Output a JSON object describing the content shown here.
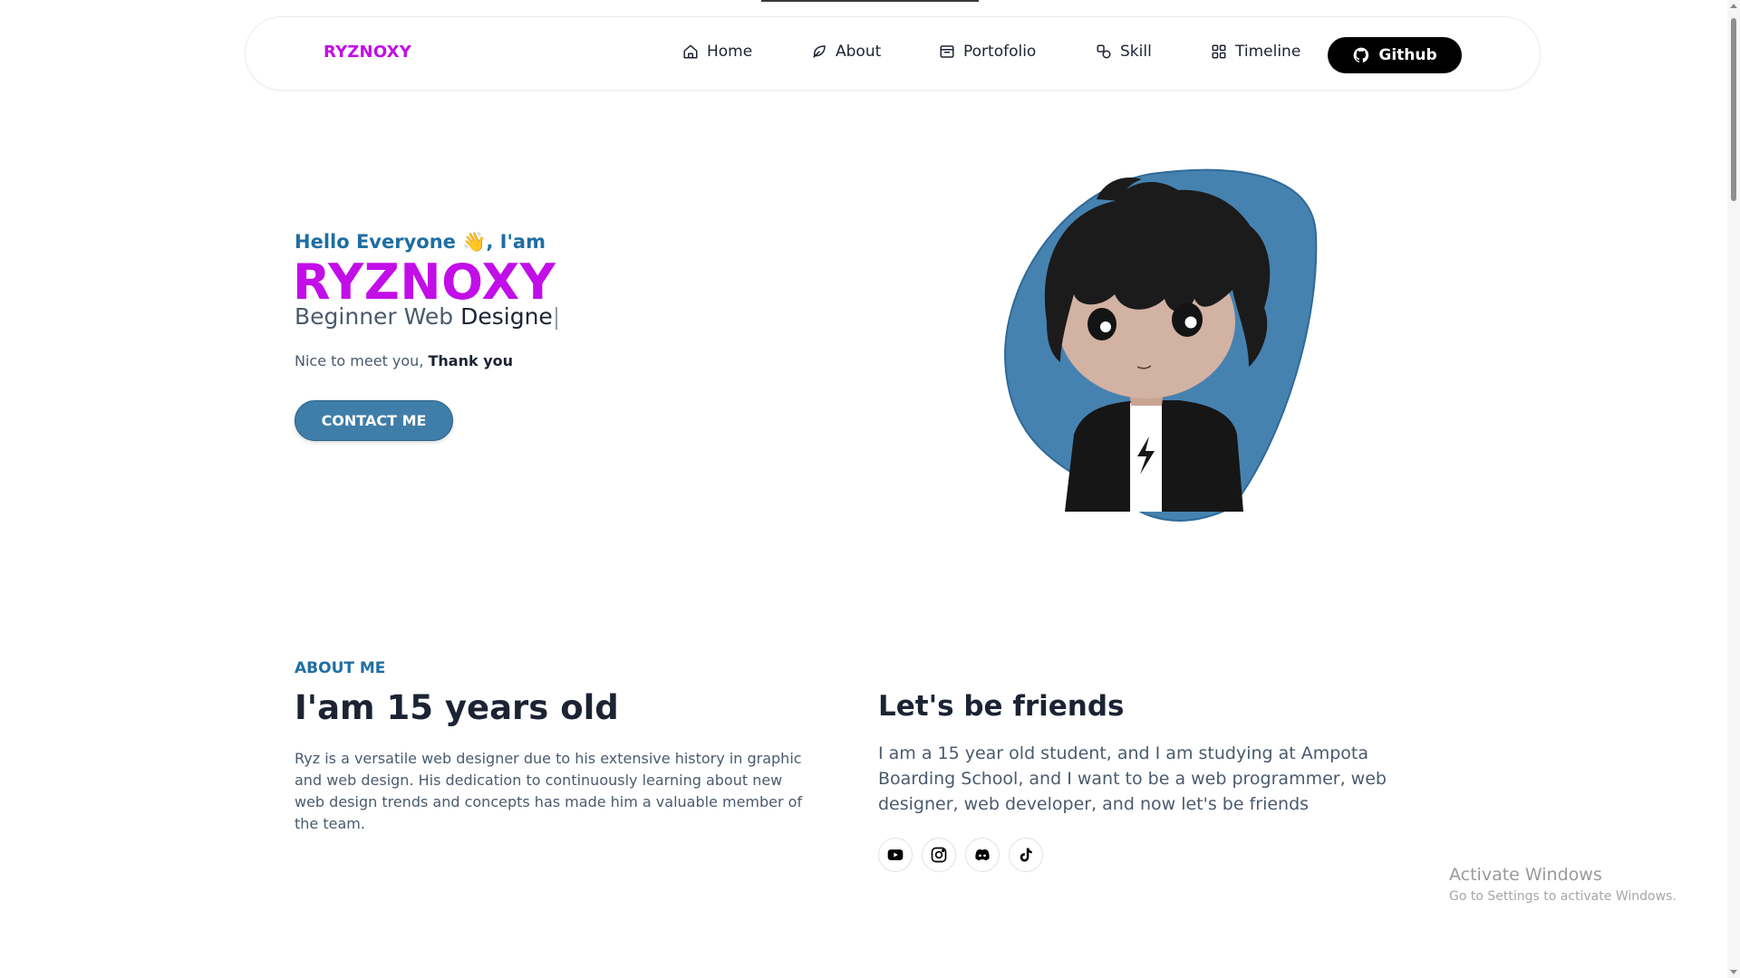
{
  "nav": {
    "brand": "RYZNOXY",
    "items": [
      {
        "label": "Home",
        "icon": "home-icon"
      },
      {
        "label": "About",
        "icon": "leaf-icon"
      },
      {
        "label": "Portofolio",
        "icon": "folder-icon"
      },
      {
        "label": "Skill",
        "icon": "shapes-icon"
      },
      {
        "label": "Timeline",
        "icon": "grid-icon"
      }
    ],
    "github_label": "Github",
    "github_icon": "github-icon"
  },
  "hero": {
    "greeting_prefix": "Hello Everyone ",
    "greeting_emoji": "👋",
    "greeting_suffix": ", I'am",
    "name": "RYZNOXY",
    "role_muted": "Beginner Web ",
    "role_highlight": "Designe",
    "caret": "|",
    "nice_prefix": "Nice to meet you, ",
    "nice_bold": "Thank you",
    "contact_label": "CONTACT ME"
  },
  "about": {
    "label": "ABOUT ME",
    "title": "I'am 15 years old",
    "text": "Ryz is a versatile web designer due to his extensive history in graphic and web design. His dedication to continuously learning about new web design trends and concepts has made him a valuable member of the team.",
    "friends_title": "Let's be friends",
    "friends_text": "I am a 15 year old student, and I am studying at Ampota Boarding School, and I want to be a web programmer, web designer, web developer, and now let's be friends",
    "socials": [
      "youtube-icon",
      "instagram-icon",
      "discord-icon",
      "tiktok-icon"
    ]
  },
  "watermark": {
    "title": "Activate Windows",
    "subtitle": "Go to Settings to activate Windows."
  },
  "colors": {
    "brand": "#c20ee8",
    "accent_blue": "#1f6ea3",
    "button_blue": "#3f7ea8",
    "avatar_blob": "#4682b0"
  }
}
